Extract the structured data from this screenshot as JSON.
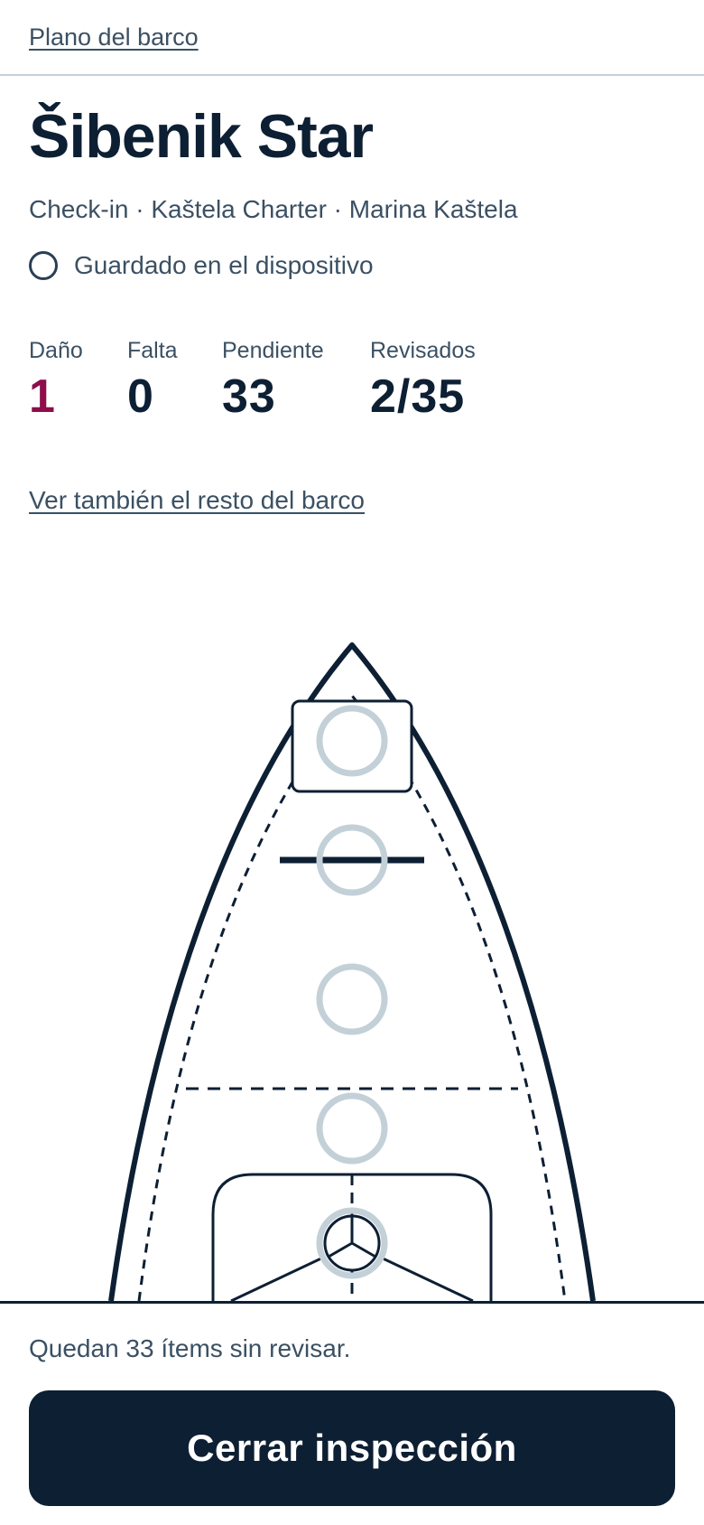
{
  "nav": {
    "back_label": "Plano del barco"
  },
  "boat": {
    "name": "Šibenik Star",
    "subtitle": "Check-in · Kaštela Charter · Marina Kaštela",
    "saved_status": "Guardado en el dispositivo"
  },
  "stats": {
    "damage": {
      "label": "Daño",
      "value": "1"
    },
    "missing": {
      "label": "Falta",
      "value": "0"
    },
    "pending": {
      "label": "Pendiente",
      "value": "33"
    },
    "checked": {
      "label": "Revisados",
      "value": "2/35"
    }
  },
  "links": {
    "see_rest": "Ver también el resto del barco"
  },
  "colors": {
    "primary": "#0d1f33",
    "damage": "#8e0d4b",
    "muted": "#3b5063",
    "checkpoint": "#c3d0d8"
  },
  "footer": {
    "remaining_text": "Quedan 33 ítems sin revisar.",
    "close_button": "Cerrar inspección"
  }
}
